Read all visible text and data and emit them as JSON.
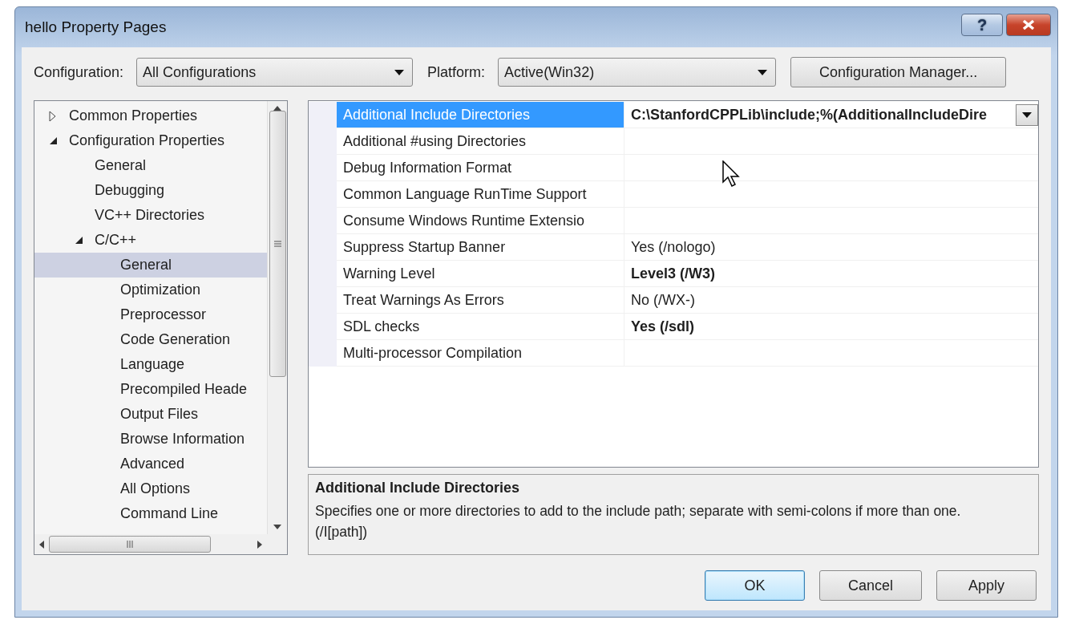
{
  "window": {
    "title": "hello Property Pages",
    "help_label": "?"
  },
  "toolbar": {
    "configuration_label": "Configuration:",
    "configuration_value": "All Configurations",
    "platform_label": "Platform:",
    "platform_value": "Active(Win32)",
    "manager_button": "Configuration Manager..."
  },
  "tree": {
    "items": [
      {
        "label": "Common Properties",
        "expanded": false,
        "selected": false
      },
      {
        "label": "Configuration Properties",
        "expanded": true,
        "selected": false,
        "children": [
          {
            "label": "General",
            "selected": false
          },
          {
            "label": "Debugging",
            "selected": false
          },
          {
            "label": "VC++ Directories",
            "selected": false
          },
          {
            "label": "C/C++",
            "expanded": true,
            "selected": false,
            "children": [
              {
                "label": "General",
                "selected": true
              },
              {
                "label": "Optimization",
                "selected": false
              },
              {
                "label": "Preprocessor",
                "selected": false
              },
              {
                "label": "Code Generation",
                "selected": false
              },
              {
                "label": "Language",
                "selected": false
              },
              {
                "label": "Precompiled Heade",
                "selected": false
              },
              {
                "label": "Output Files",
                "selected": false
              },
              {
                "label": "Browse Information",
                "selected": false
              },
              {
                "label": "Advanced",
                "selected": false
              },
              {
                "label": "All Options",
                "selected": false
              },
              {
                "label": "Command Line",
                "selected": false
              }
            ]
          }
        ]
      }
    ]
  },
  "grid": {
    "rows": [
      {
        "name": "Additional Include Directories",
        "value": "C:\\StanfordCPPLib\\include;%(AdditionalIncludeDire",
        "bold": true,
        "selected": true,
        "dropdown": true
      },
      {
        "name": "Additional #using Directories",
        "selected": false
      },
      {
        "name": "Debug Information Format",
        "selected": false
      },
      {
        "name": "Common Language RunTime Support",
        "selected": false
      },
      {
        "name": "Consume Windows Runtime Extensio",
        "selected": false
      },
      {
        "name": "Suppress Startup Banner",
        "value": "Yes (/nologo)",
        "bold": false,
        "selected": false
      },
      {
        "name": "Warning Level",
        "value": "Level3 (/W3)",
        "bold": true,
        "selected": false
      },
      {
        "name": "Treat Warnings As Errors",
        "value": "No (/WX-)",
        "bold": false,
        "selected": false
      },
      {
        "name": "SDL checks",
        "value": "Yes (/sdl)",
        "bold": true,
        "selected": false
      },
      {
        "name": "Multi-processor Compilation",
        "selected": false
      }
    ]
  },
  "description": {
    "title": "Additional Include Directories",
    "text": "Specifies one or more directories to add to the include path; separate with semi-colons if more than one.     (/I[path])"
  },
  "buttons": [
    {
      "label": "OK",
      "default": true
    },
    {
      "label": "Cancel",
      "default": false
    },
    {
      "label": "Apply",
      "default": false
    }
  ]
}
